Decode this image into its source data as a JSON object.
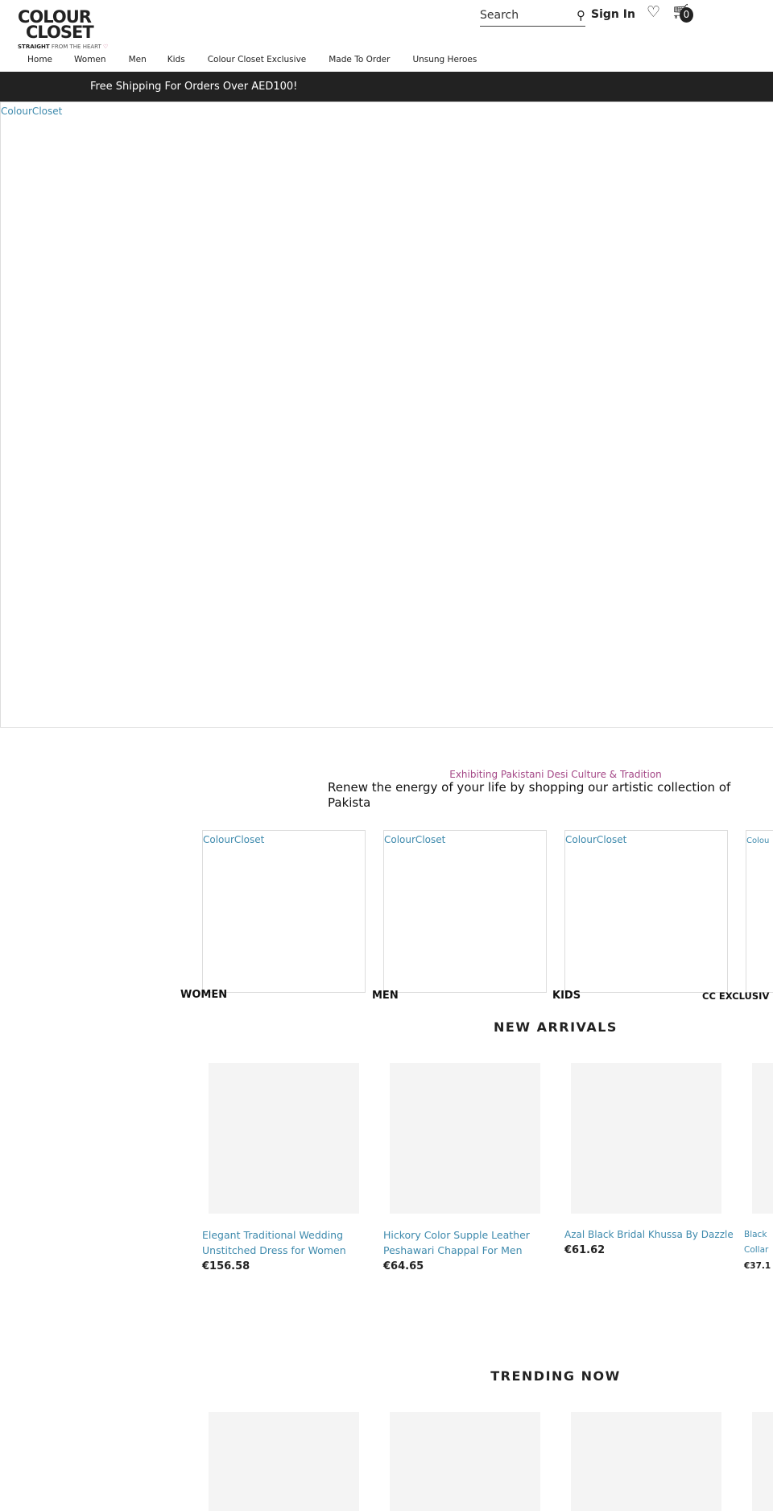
{
  "header": {
    "logo_line1": "COLOUR",
    "logo_line2": "CLOSET",
    "logo_tagline_bold": "STRAIGHT",
    "logo_tagline": "FROM THE HEART",
    "search_placeholder": "Search",
    "sign_in": "Sign In",
    "cart_count": "0"
  },
  "nav": [
    "Home",
    "Women",
    "Men",
    "Kids",
    "Colour Closet Exclusive",
    "Made To Order",
    "Unsung Heroes"
  ],
  "promo_bar": "Free Shipping For Orders Over AED100!",
  "hero_alt": "ColourCloset",
  "intro": {
    "tagline": "Exhibiting Pakistani Desi Culture & Tradition",
    "heading": "Renew the energy of your life by shopping our artistic collection of Pakista"
  },
  "categories": [
    {
      "alt": "ColourCloset",
      "label": "WOMEN"
    },
    {
      "alt": "ColourCloset",
      "label": "MEN"
    },
    {
      "alt": "ColourCloset",
      "label": "KIDS"
    },
    {
      "alt": "Colou",
      "label": "CC EXCLUSIV"
    }
  ],
  "new_arrivals": {
    "title": "NEW ARRIVALS",
    "products": [
      {
        "title": "Elegant Traditional Wedding Unstitched Dress for Women",
        "price": "€156.58"
      },
      {
        "title": "Hickory Color Supple Leather Peshawari Chappal For Men",
        "price": "€64.65"
      },
      {
        "title": "Azal Black Bridal Khussa By Dazzle",
        "price": "€61.62"
      },
      {
        "title": "Black Collar",
        "price": "€37.1"
      }
    ]
  },
  "trending": {
    "title": "TRENDING NOW"
  },
  "colors": {
    "accent_link": "#3e8aad",
    "tagline": "#a44786",
    "bar": "#222222"
  }
}
